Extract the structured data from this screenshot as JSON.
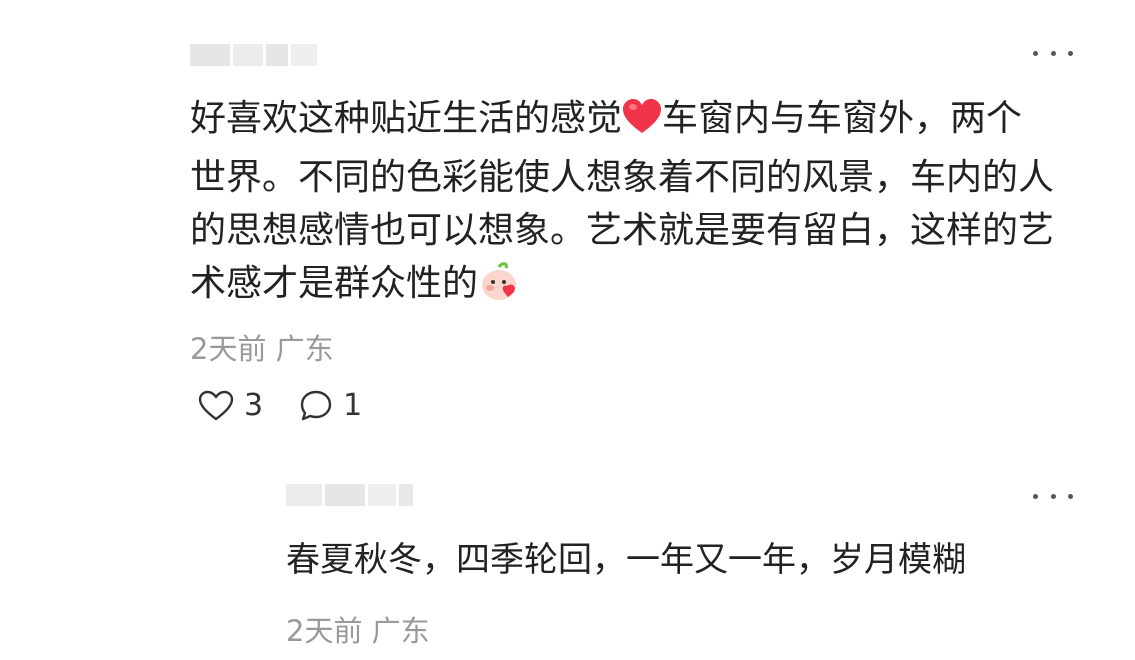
{
  "comment": {
    "lines": [
      "好喜欢这种贴近生活的感觉",
      "车窗内与车窗外，两个",
      "世界。不同的色彩能使人想象着不同的风景，车内的人",
      "的思想感情也可以想象。艺术就是要有留白，这样的艺",
      "术感才是群众性的"
    ],
    "heart_emoji": "heart-emoji",
    "face_emoji": "blushing-peach-emoji",
    "time": "2天前",
    "location": "广东",
    "likes": "3",
    "replies": "1"
  },
  "reply": {
    "text": "春夏秋冬，四季轮回，一年又一年，岁月模糊",
    "time": "2天前",
    "location": "广东"
  },
  "colors": {
    "text": "#222222",
    "meta": "#999999",
    "heart": "#f2344a"
  }
}
